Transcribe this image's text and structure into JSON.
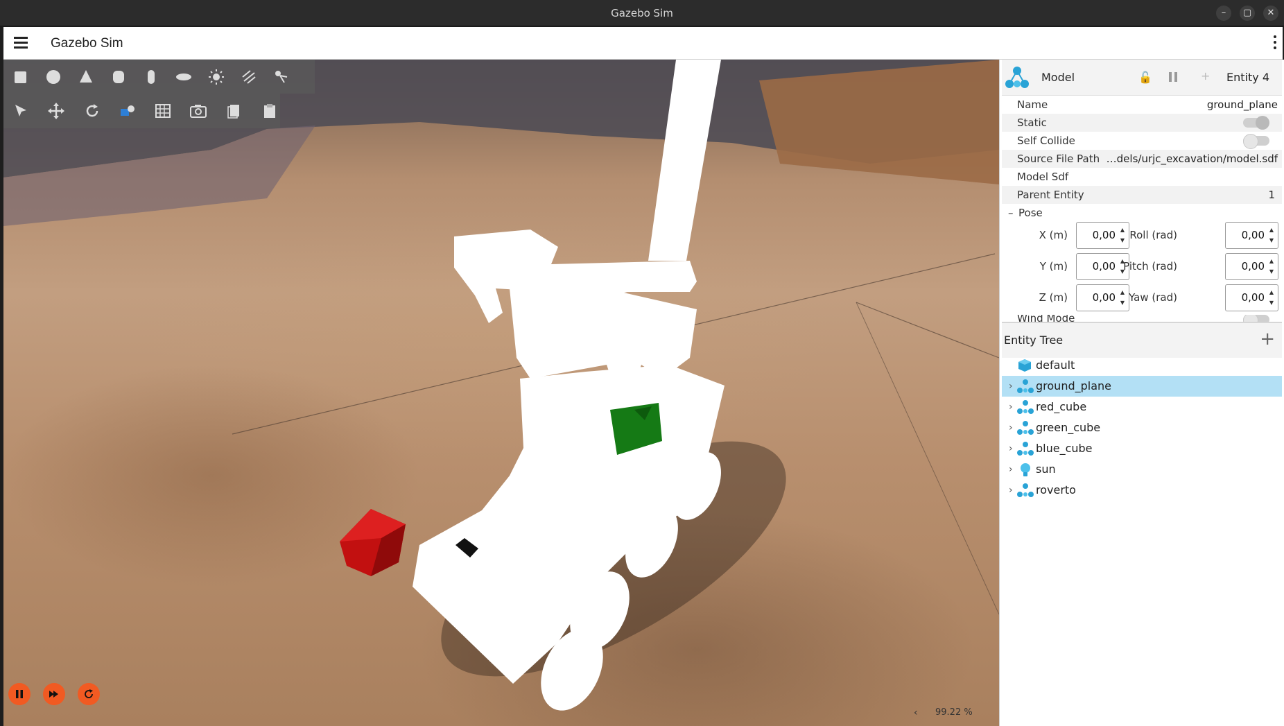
{
  "window": {
    "title": "Gazebo Sim",
    "controls": [
      "–",
      "▢",
      "✕"
    ]
  },
  "header": {
    "title": "Gazebo Sim"
  },
  "toolbar": {
    "shapes": [
      "box-icon",
      "sphere-icon",
      "cone-icon",
      "cylinder-icon",
      "capsule-icon",
      "ellipsoid-icon",
      "sun-icon",
      "directional-light-icon",
      "spot-light-icon"
    ],
    "tools": [
      "select-icon",
      "translate-icon",
      "rotate-icon",
      "transform-control-icon",
      "grid-icon",
      "screenshot-icon",
      "copy-icon",
      "paste-icon"
    ]
  },
  "playback": {
    "rtf_label": "99.22 %",
    "rtf_arrow": "‹",
    "accent": "#f15a22"
  },
  "component_inspector": {
    "title": "Model",
    "entity_label": "Entity 4",
    "properties": [
      {
        "label": "Name",
        "value": "ground_plane"
      },
      {
        "label": "Static",
        "value": ""
      },
      {
        "label": "Self Collide",
        "value": ""
      },
      {
        "label": "Source File Path",
        "value": "…dels/urjc_excavation/model.sdf"
      },
      {
        "label": "Model Sdf",
        "value": ""
      },
      {
        "label": "Parent Entity",
        "value": "1"
      }
    ],
    "toggles": {
      "static": true,
      "self_collide": false,
      "wind_mode": false
    },
    "pose": {
      "label": "Pose",
      "collapse_symbol": "–",
      "fields": [
        {
          "label": "X (m)",
          "value": "0,00"
        },
        {
          "label": "Roll (rad)",
          "value": "0,00"
        },
        {
          "label": "Y (m)",
          "value": "0,00"
        },
        {
          "label": "Pitch (rad)",
          "value": "0,00"
        },
        {
          "label": "Z (m)",
          "value": "0,00"
        },
        {
          "label": "Yaw (rad)",
          "value": "0,00"
        }
      ]
    },
    "wind_mode_label": "Wind Mode"
  },
  "entity_tree": {
    "title": "Entity Tree",
    "add_symbol": "+",
    "items": [
      {
        "name": "default",
        "icon": "world-icon",
        "expandable": false,
        "selected": false
      },
      {
        "name": "ground_plane",
        "icon": "model-icon",
        "expandable": true,
        "selected": true
      },
      {
        "name": "red_cube",
        "icon": "model-icon",
        "expandable": true,
        "selected": false
      },
      {
        "name": "green_cube",
        "icon": "model-icon",
        "expandable": true,
        "selected": false
      },
      {
        "name": "blue_cube",
        "icon": "model-icon",
        "expandable": true,
        "selected": false
      },
      {
        "name": "sun",
        "icon": "light-icon",
        "expandable": true,
        "selected": false
      },
      {
        "name": "roverto",
        "icon": "model-icon",
        "expandable": true,
        "selected": false
      }
    ],
    "expand_symbol": "›"
  }
}
